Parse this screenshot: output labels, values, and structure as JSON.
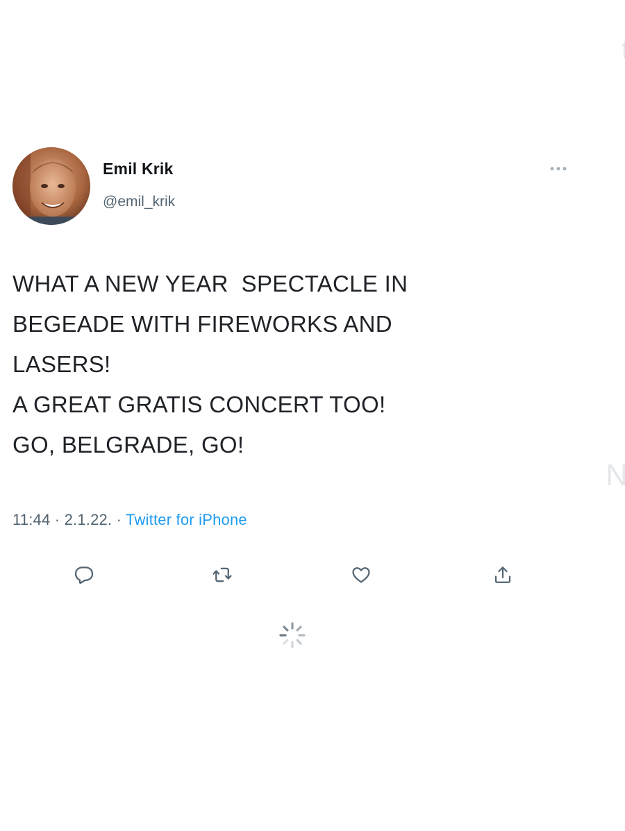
{
  "author": {
    "name": "Emil Krik",
    "handle": "@emil_krik",
    "avatar_icon": "user-avatar-photo"
  },
  "tweet": {
    "lines": [
      "WHAT A NEW YEAR  SPECTACLE IN",
      "BEGEADE WITH FIREWORKS AND",
      "LASERS!",
      "A GREAT GRATIS CONCERT TOO!",
      "GO, BELGRADE, GO!"
    ],
    "time": "11:44",
    "date": "2.1.22.",
    "separator": "·",
    "source": "Twitter for iPhone"
  },
  "actions": {
    "reply_icon": "reply-icon",
    "retweet_icon": "retweet-icon",
    "like_icon": "like-icon",
    "share_icon": "share-icon",
    "more_icon": "more-icon"
  },
  "colors": {
    "text": "#0f1419",
    "secondary": "#536471",
    "link": "#1d9bf0",
    "icon": "#536471"
  }
}
